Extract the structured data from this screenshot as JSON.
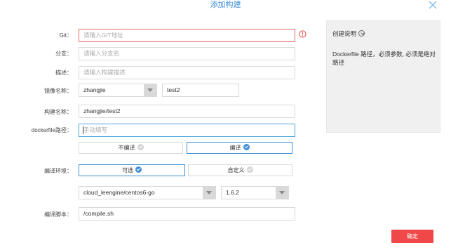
{
  "dialog": {
    "title": "添加构建",
    "close_icon": "close-icon"
  },
  "form": {
    "git": {
      "label": "Git：",
      "placeholder": "请输入GIT地址",
      "value": "",
      "state": "error"
    },
    "branch": {
      "label": "分支：",
      "placeholder": "请输入分支名",
      "value": ""
    },
    "description": {
      "label": "描述：",
      "placeholder": "请输入构建描述",
      "value": ""
    },
    "image_name": {
      "label": "镜像名称：",
      "namespace": "zhangjie",
      "name": "test2"
    },
    "build_name": {
      "label": "构建名称：",
      "value": "zhangjie/test2"
    },
    "dockerfile_path": {
      "label": "dockerfile路径：",
      "placeholder": "手动填写",
      "value": ""
    },
    "compile_toggle": {
      "options": [
        "不编译",
        "编译"
      ],
      "selected": "编译"
    },
    "compile_env": {
      "label": "编译环境：",
      "options": [
        "可选",
        "自定义"
      ],
      "selected": "可选"
    },
    "env_image": {
      "value": "cloud_leengine/centos6-go"
    },
    "env_version": {
      "value": "1.6.2"
    },
    "compile_script": {
      "label": "编译脚本：",
      "value": "/compile.sh"
    }
  },
  "help": {
    "title": "创建说明",
    "text": "Dockerfile 路径，必须参数, 必须是绝对路径"
  },
  "actions": {
    "confirm_label": "确定"
  },
  "colors": {
    "accent": "#3d8fd8",
    "error": "#e86b6b",
    "confirm": "#f04848"
  }
}
